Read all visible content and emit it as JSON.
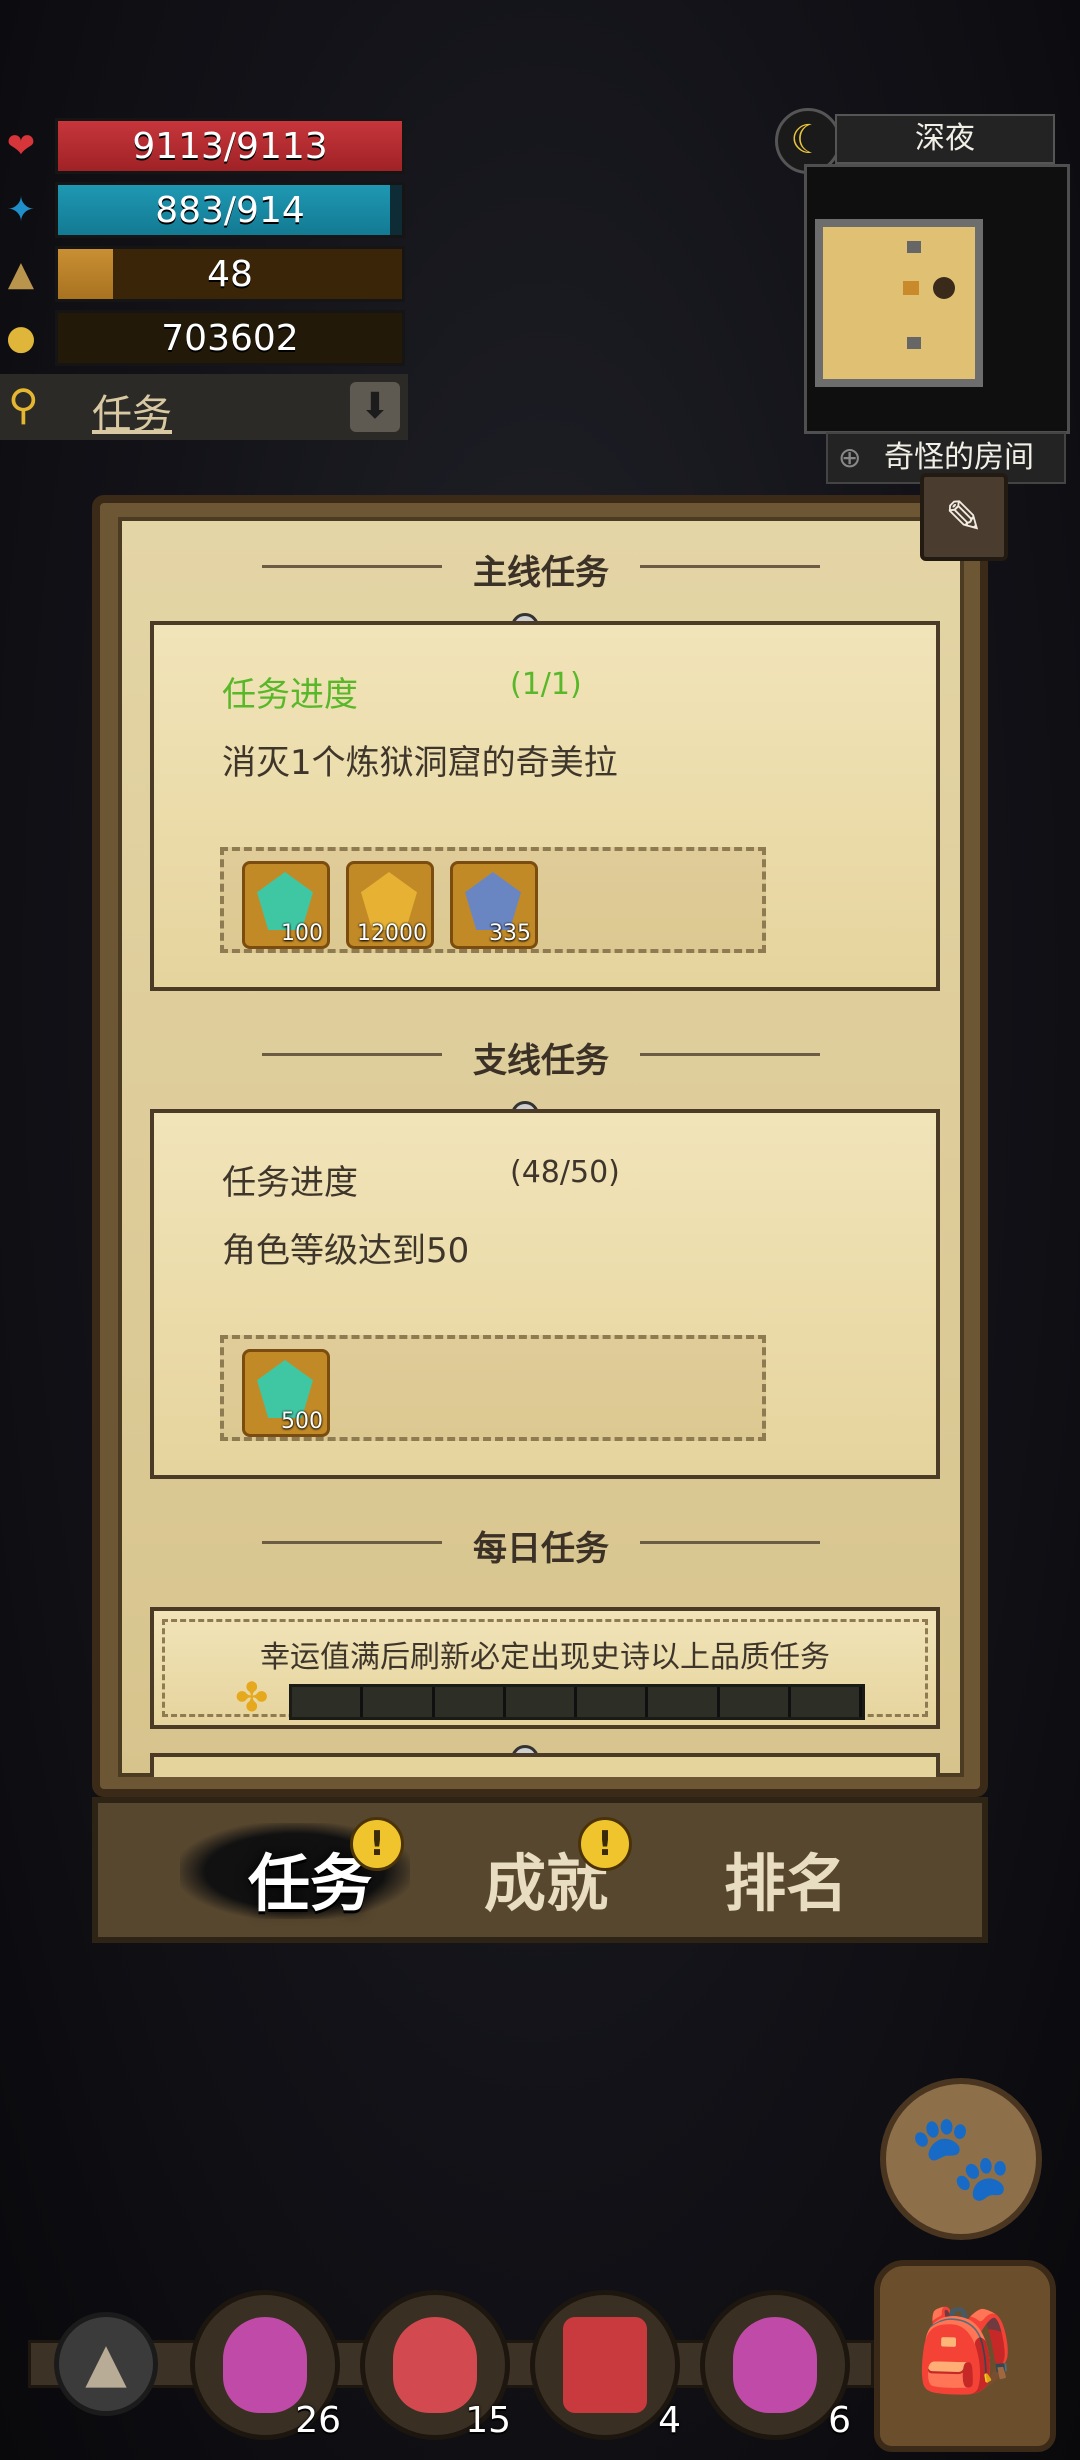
{
  "stats": {
    "hp": "9113/9113",
    "mp": "883/914",
    "mp_fraction": 0.966,
    "xp_level": "48",
    "xp_fraction": 0.16,
    "gold": "703602"
  },
  "search": {
    "label": "任务"
  },
  "minimap": {
    "time": "深夜",
    "room_name": "奇怪的房间"
  },
  "main_quest": {
    "title": "主线任务",
    "progress_label": "任务进度",
    "progress_count": "(1/1)",
    "description": "消灭1个炼狱洞窟的奇美拉",
    "rewards": [
      {
        "name": "green-crystal-icon",
        "qty": "100",
        "color": "#3fc7a3"
      },
      {
        "name": "gold-ore-icon",
        "qty": "12000",
        "color": "#e7b233"
      },
      {
        "name": "blue-ore-icon",
        "qty": "335",
        "color": "#6a86c2"
      }
    ]
  },
  "side_quest": {
    "title": "支线任务",
    "progress_label": "任务进度",
    "progress_count": "(48/50)",
    "description": "角色等级达到50",
    "rewards": [
      {
        "name": "green-crystal-icon",
        "qty": "500",
        "color": "#3fc7a3"
      }
    ]
  },
  "daily_quest": {
    "title": "每日任务",
    "hint": "幸运值满后刷新必定出现史诗以上品质任务",
    "luck_segments": 8
  },
  "tabs": [
    {
      "label": "任务",
      "active": true,
      "badge": "!"
    },
    {
      "label": "成就",
      "active": false,
      "badge": "!"
    },
    {
      "label": "排名",
      "active": false,
      "badge": ""
    }
  ],
  "quickbar": [
    {
      "name": "purple-potion-icon",
      "count": "26",
      "color": "#c04aa8"
    },
    {
      "name": "red-potion-icon",
      "count": "15",
      "color": "#d24a4f"
    },
    {
      "name": "red-scroll-icon",
      "count": "4",
      "color": "#c83a3d"
    },
    {
      "name": "purple-potion-icon",
      "count": "6",
      "color": "#c04aa8"
    }
  ],
  "colors": {
    "accent_green": "#58b82a",
    "hp_red": "#c6363b",
    "mp_blue": "#1f98b3",
    "xp_gold": "#c98f33"
  }
}
